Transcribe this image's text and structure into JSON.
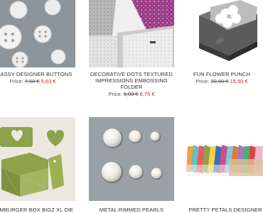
{
  "products": [
    {
      "name": "CLASSY DESIGNER BUTTONS",
      "price_label": "Price:",
      "old_price": "7,50 €",
      "new_price": "5,63 €",
      "image_label": "buttons-photo"
    },
    {
      "name": "DECORATIVE DOTS TEXTURED IMPRESSIONS EMBOSSING FOLDER",
      "price_label": "Price:",
      "old_price": "9,00 €",
      "new_price": "6,75 €",
      "image_label": "embossing-folder-photo"
    },
    {
      "name": "FUN FLOWER PUNCH",
      "price_label": "Price:",
      "old_price": "22,00 €",
      "new_price": "16,50 €",
      "image_label": "punch-photo"
    },
    {
      "name": "HAMBURGER BOX BIGZ XL DIE",
      "image_label": "hamburger-box-photo"
    },
    {
      "name": "METAL RIMMED PEARLS",
      "image_label": "pearls-photo"
    },
    {
      "name": "PRETTY PETALS DESIGNER",
      "image_label": "petals-photo"
    }
  ],
  "colors": {
    "sale_red": "#cc2222",
    "purple_folder": "#9b3a86",
    "green_card": "#8ea24a"
  }
}
